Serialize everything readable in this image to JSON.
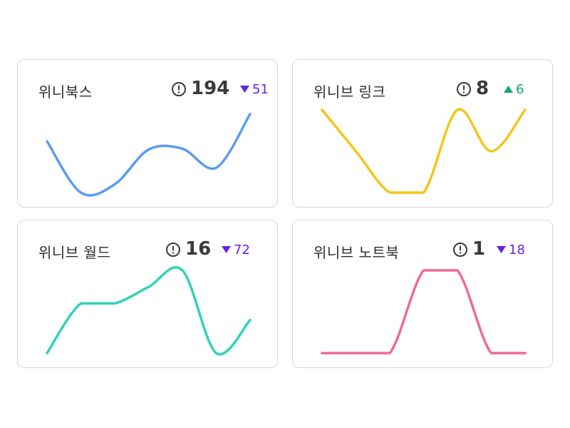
{
  "colors": {
    "down": "#6a1fe8",
    "up": "#17a765",
    "icon": "#3a3a3a"
  },
  "cards": [
    {
      "title": "위니북스",
      "count": "194",
      "trend": {
        "direction": "down",
        "value": "51"
      },
      "line_color": "#5b9cf2"
    },
    {
      "title": "위니브 링크",
      "count": "8",
      "trend": {
        "direction": "up",
        "value": "6"
      },
      "line_color": "#f5c518"
    },
    {
      "title": "위니브 월드",
      "count": "16",
      "trend": {
        "direction": "down",
        "value": "72"
      },
      "line_color": "#2fd3b7"
    },
    {
      "title": "위니브 노트북",
      "count": "1",
      "trend": {
        "direction": "down",
        "value": "18"
      },
      "line_color": "#f06a93"
    }
  ],
  "chart_data": [
    {
      "type": "line",
      "title": "위니북스",
      "y": [
        62,
        0,
        10,
        52,
        53,
        30,
        95
      ],
      "ylim": [
        0,
        100
      ]
    },
    {
      "type": "line",
      "title": "위니브 링크",
      "y": [
        100,
        50,
        0,
        0,
        100,
        50,
        100
      ],
      "ylim": [
        0,
        100
      ]
    },
    {
      "type": "line",
      "title": "위니브 월드",
      "y": [
        0,
        60,
        60,
        80,
        100,
        0,
        40
      ],
      "ylim": [
        0,
        100
      ]
    },
    {
      "type": "line",
      "title": "위니브 노트북",
      "y": [
        0,
        0,
        0,
        100,
        100,
        0,
        0
      ],
      "ylim": [
        0,
        100
      ]
    }
  ]
}
